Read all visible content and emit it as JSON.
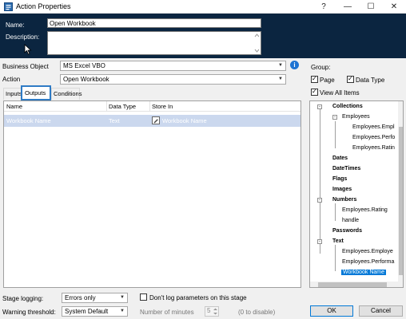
{
  "window": {
    "title": "Action Properties",
    "help_glyph": "?",
    "minimize_glyph": "—",
    "maximize_glyph": "☐",
    "close_glyph": "✕"
  },
  "header": {
    "name_label": "Name:",
    "name_value": "Open Workbook",
    "description_label": "Description:",
    "description_value": ""
  },
  "form": {
    "business_object_label": "Business Object",
    "business_object_value": "MS Excel VBO",
    "action_label": "Action",
    "action_value": "Open Workbook",
    "info_glyph": "i"
  },
  "tabs": [
    {
      "label": "Inputs"
    },
    {
      "label": "Outputs"
    },
    {
      "label": "Conditions"
    }
  ],
  "outputs_table": {
    "columns": [
      "Name",
      "Data Type",
      "Store In"
    ],
    "rows": [
      {
        "name": "Workbook Name",
        "data_type": "Text",
        "store_in": "Workbook Name"
      }
    ]
  },
  "group": {
    "label": "Group:",
    "page_label": "Page",
    "page_checked": true,
    "data_type_label": "Data Type",
    "data_type_checked": true,
    "view_all_label": "View All Items",
    "view_all_checked": true
  },
  "tree": {
    "collections": "Collections",
    "employees": "Employees",
    "emp_children": [
      "Employees.Empl",
      "Employees.Perfo",
      "Employees.Ratin"
    ],
    "dates": "Dates",
    "datetimes": "DateTimes",
    "flags": "Flags",
    "images": "Images",
    "numbers": "Numbers",
    "num_children": [
      "Employees.Rating",
      "handle"
    ],
    "passwords": "Passwords",
    "text": "Text",
    "text_children": [
      "Employees.Employe",
      "Employees.Performa",
      "Workbook Name"
    ]
  },
  "footer": {
    "stage_logging_label": "Stage logging:",
    "stage_logging_value": "Errors only",
    "dont_log_label": "Don't log parameters on this stage",
    "dont_log_checked": false,
    "warning_label": "Warning threshold:",
    "warning_value": "System Default",
    "minutes_label": "Number of minutes",
    "minutes_value": "5",
    "disable_hint": "(0 to disable)",
    "ok_label": "OK",
    "cancel_label": "Cancel"
  },
  "colors": {
    "header_bg": "#0b2540",
    "selection": "#0078d7",
    "row_highlight": "#cbd8ee"
  }
}
